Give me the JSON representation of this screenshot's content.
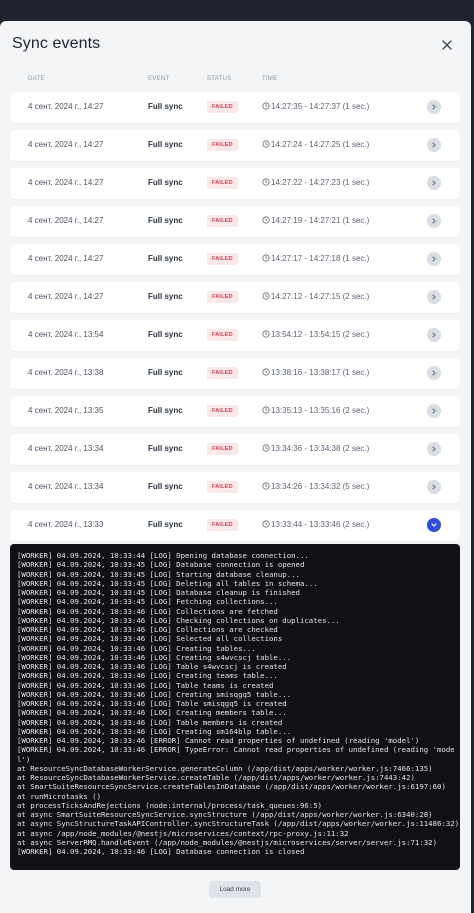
{
  "modal": {
    "title": "Sync events",
    "columns": {
      "date": "DATE",
      "event": "EVENT",
      "status": "STATUS",
      "time": "TIME"
    },
    "load_more_label": "Load more"
  },
  "rows": [
    {
      "date": "4 сент. 2024 г., 14:27",
      "event": "Full sync",
      "status": "FAILED",
      "time": "14:27:35 - 14:27:37 (1 sec.)",
      "expanded": false
    },
    {
      "date": "4 сент. 2024 г., 14:27",
      "event": "Full sync",
      "status": "FAILED",
      "time": "14:27:24 - 14:27:25 (1 sec.)",
      "expanded": false
    },
    {
      "date": "4 сент. 2024 г., 14:27",
      "event": "Full sync",
      "status": "FAILED",
      "time": "14:27:22 - 14:27:23 (1 sec.)",
      "expanded": false
    },
    {
      "date": "4 сент. 2024 г., 14:27",
      "event": "Full sync",
      "status": "FAILED",
      "time": "14:27:19 - 14:27:21 (1 sec.)",
      "expanded": false
    },
    {
      "date": "4 сент. 2024 г., 14:27",
      "event": "Full sync",
      "status": "FAILED",
      "time": "14:27:17 - 14:27:18 (1 sec.)",
      "expanded": false
    },
    {
      "date": "4 сент. 2024 г., 14:27",
      "event": "Full sync",
      "status": "FAILED",
      "time": "14:27:12 - 14:27:15 (2 sec.)",
      "expanded": false
    },
    {
      "date": "4 сент. 2024 г., 13:54",
      "event": "Full sync",
      "status": "FAILED",
      "time": "13:54:12 - 13:54:15 (2 sec.)",
      "expanded": false
    },
    {
      "date": "4 сент. 2024 г., 13:38",
      "event": "Full sync",
      "status": "FAILED",
      "time": "13:38:16 - 13:38:17 (1 sec.)",
      "expanded": false
    },
    {
      "date": "4 сент. 2024 г., 13:35",
      "event": "Full sync",
      "status": "FAILED",
      "time": "13:35:13 - 13:35:16 (2 sec.)",
      "expanded": false
    },
    {
      "date": "4 сент. 2024 г., 13:34",
      "event": "Full sync",
      "status": "FAILED",
      "time": "13:34:36 - 13:34:38 (2 sec.)",
      "expanded": false
    },
    {
      "date": "4 сент. 2024 г., 13:34",
      "event": "Full sync",
      "status": "FAILED",
      "time": "13:34:26 - 13:34:32 (5 sec.)",
      "expanded": false
    },
    {
      "date": "4 сент. 2024 г., 13:33",
      "event": "Full sync",
      "status": "FAILED",
      "time": "13:33:44 - 13:33:46 (2 sec.)",
      "expanded": true
    }
  ],
  "log_lines": [
    "[WORKER] 04.09.2024, 10:33:44 [LOG] Opening database connection...",
    "[WORKER] 04.09.2024, 10:33:45 [LOG] Database connection is opened",
    "[WORKER] 04.09.2024, 10:33:45 [LOG] Starting database cleanup...",
    "[WORKER] 04.09.2024, 10:33:45 [LOG] Deleting all tables in schema...",
    "[WORKER] 04.09.2024, 10:33:45 [LOG] Database cleanup is finished",
    "[WORKER] 04.09.2024, 10:33:45 [LOG] Fetching collections...",
    "[WORKER] 04.09.2024, 10:33:46 [LOG] Collections are fetched",
    "[WORKER] 04.09.2024, 10:33:46 [LOG] Checking collections on duplicates...",
    "[WORKER] 04.09.2024, 10:33:46 [LOG] Collections are checked",
    "[WORKER] 04.09.2024, 10:33:46 [LOG] Selected all collections",
    "[WORKER] 04.09.2024, 10:33:46 [LOG] Creating tables...",
    "[WORKER] 04.09.2024, 10:33:46 [LOG] Creating s4wvcscj table...",
    "[WORKER] 04.09.2024, 10:33:46 [LOG] Table s4wvcscj is created",
    "[WORKER] 04.09.2024, 10:33:46 [LOG] Creating teams table...",
    "[WORKER] 04.09.2024, 10:33:46 [LOG] Table teams is created",
    "[WORKER] 04.09.2024, 10:33:46 [LOG] Creating smisqgq5 table...",
    "[WORKER] 04.09.2024, 10:33:46 [LOG] Table smisqgq5 is created",
    "[WORKER] 04.09.2024, 10:33:46 [LOG] Creating members table...",
    "[WORKER] 04.09.2024, 10:33:46 [LOG] Table members is created",
    "[WORKER] 04.09.2024, 10:33:46 [LOG] Creating sm164blp table...",
    "[WORKER] 04.09.2024, 10:33:46 [ERROR] Cannot read properties of undefined (reading 'model')",
    "[WORKER] 04.09.2024, 10:33:46 [ERROR] TypeError: Cannot read properties of undefined (reading 'mode",
    "l')",
    "at ResourceSyncDatabaseWorkerService.generateColumn (/app/dist/apps/worker/worker.js:7466:135)",
    "at ResourceSyncDatabaseWorkerService.createTable (/app/dist/apps/worker/worker.js:7443:42)",
    "at SmartSuiteResourceSyncService.createTablesInDatabase (/app/dist/apps/worker/worker.js:6197:60)",
    "at runMicrotasks ()",
    "at processTicksAndRejections (node:internal/process/task_queues:96:5)",
    "at async SmartSuiteResourceSyncService.syncStructure (/app/dist/apps/worker/worker.js:6340:28)",
    "at async SyncStructureTaskAPIController.syncStructureTask (/app/dist/apps/worker/worker.js:11486:32)",
    "at async /app/node_modules/@nestjs/microservices/context/rpc-proxy.js:11:32",
    "at async ServerRMQ.handleEvent (/app/node_modules/@nestjs/microservices/server/server.js:71:32)",
    "[WORKER] 04.09.2024, 10:33:46 [LOG] Database connection is closed"
  ],
  "colors": {
    "failed_bg": "#fbe6e8",
    "failed_text": "#d04456",
    "accent": "#2f4fd8",
    "log_bg": "#101114"
  }
}
